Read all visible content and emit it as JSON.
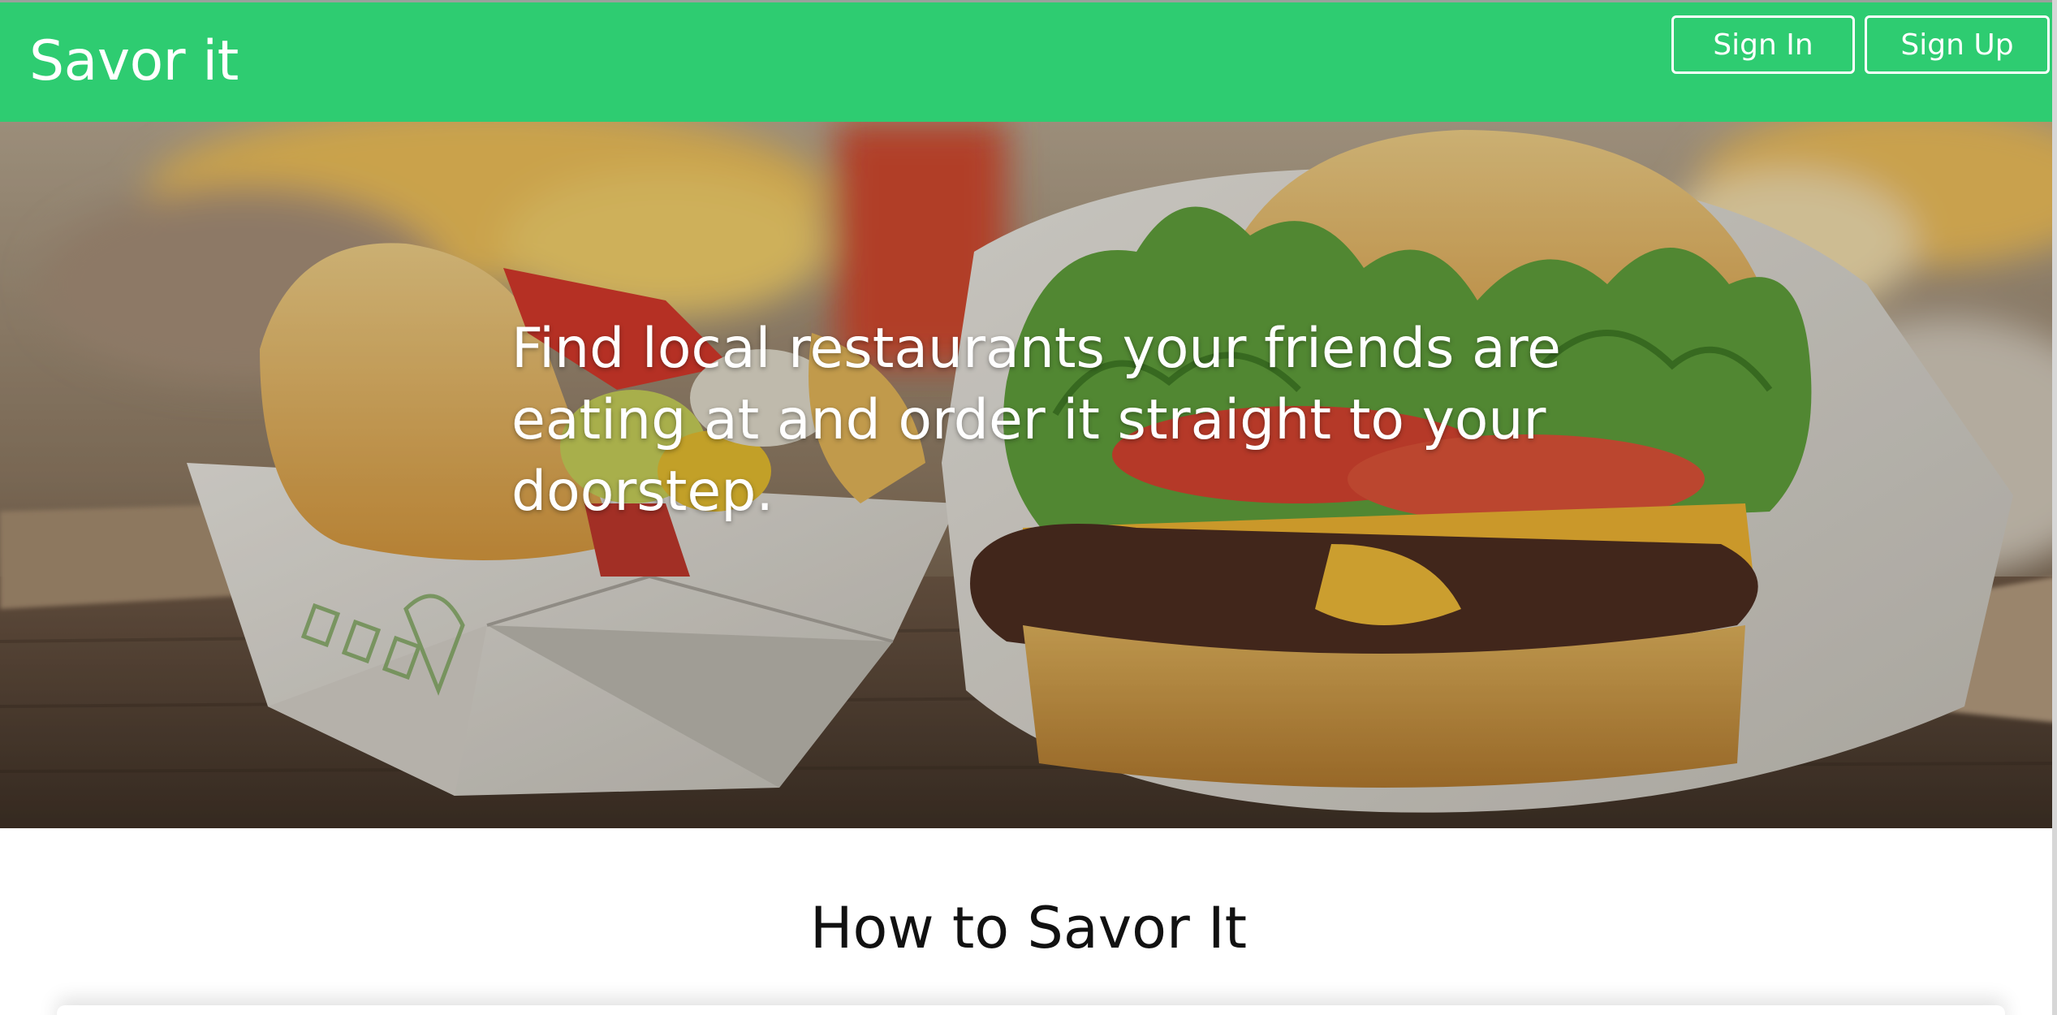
{
  "header": {
    "brand": "Savor it",
    "sign_in_label": "Sign In",
    "sign_up_label": "Sign Up"
  },
  "hero": {
    "tagline": "Find local restaurants your friends are eating at and order it straight to your doorstep."
  },
  "howto": {
    "title": "How to Savor It"
  },
  "colors": {
    "header_green": "#2ecc71",
    "text_on_green": "#ffffff"
  }
}
